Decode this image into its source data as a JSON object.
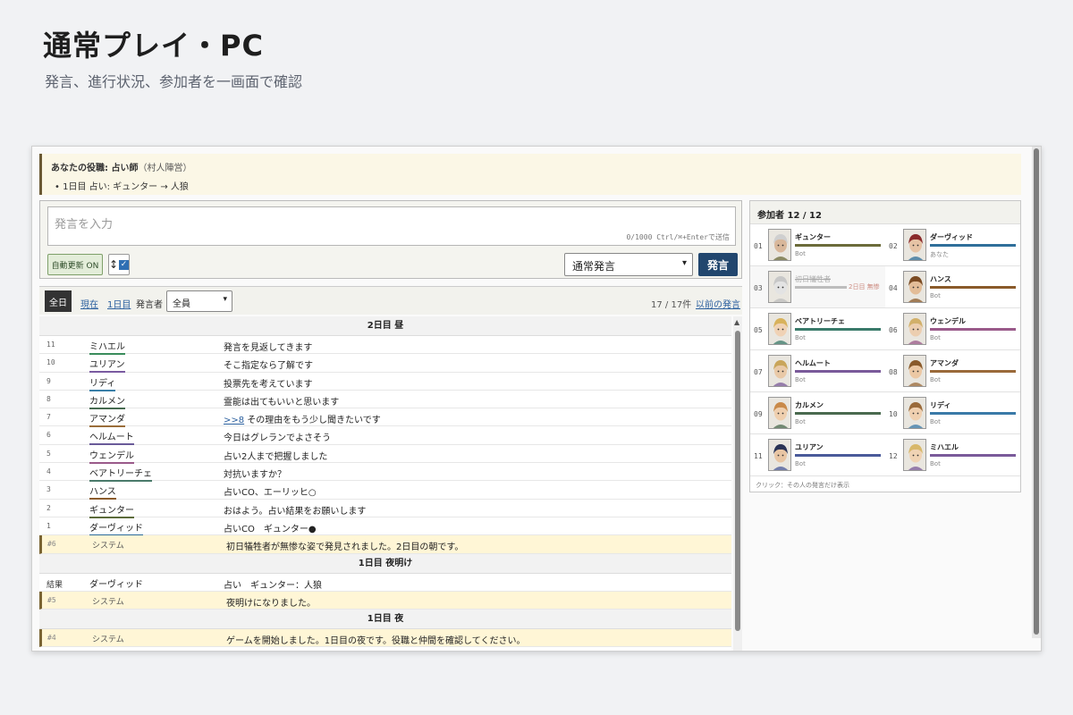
{
  "hero": {
    "title": "通常プレイ・PC",
    "subtitle": "発言、進行状況、参加者を一画面で確認"
  },
  "role": {
    "label": "あなたの役職: 占い師",
    "team": "（村人陣営）",
    "result": "1日目 占い: ギュンター → 人狼"
  },
  "composer": {
    "placeholder": "発言を入力",
    "counter": "0/1000  Ctrl/⌘+Enterで送信",
    "auto_refresh_label": "自動更新 ON",
    "scroll_label": "↕",
    "mode_selected": "通常発言",
    "submit_label": "発言"
  },
  "filter": {
    "all_label": "全日",
    "current_label": "現在",
    "day1_label": "1日目",
    "speaker_label": "発言者",
    "speaker_selected": "全員",
    "count": "17 / 17件",
    "older_label": "以前の発言"
  },
  "log": {
    "day2_header": "2日目 昼",
    "day2_rows": [
      {
        "no": "11",
        "name": "ミハエル",
        "text": "発言を見返してきます",
        "color": "#3a8c5c"
      },
      {
        "no": "10",
        "name": "ユリアン",
        "text": "そこ指定なら了解です",
        "color": "#7a5aa0"
      },
      {
        "no": "9",
        "name": "リディ",
        "text": "投票先を考えています",
        "color": "#3a7fa8"
      },
      {
        "no": "8",
        "name": "カルメン",
        "text": "霊能は出てもいいと思います",
        "color": "#466a4f"
      },
      {
        "no": "7",
        "name": "アマンダ",
        "text": "その理由をもう少し聞きたいです",
        "anchor": ">>8",
        "color": "#9a6d3a"
      },
      {
        "no": "6",
        "name": "ヘルムート",
        "text": "今日はグレランでよさそう",
        "color": "#6a5a99"
      },
      {
        "no": "5",
        "name": "ウェンデル",
        "text": "占い2人まで把握しました",
        "color": "#9a5a8a"
      },
      {
        "no": "4",
        "name": "ベアトリーチェ",
        "text": "対抗いますか？",
        "color": "#4a7a6a"
      },
      {
        "no": "3",
        "name": "ハンス",
        "text": "占いCO、エーリッヒ○",
        "color": "#8a5a2a"
      },
      {
        "no": "2",
        "name": "ギュンター",
        "text": "おはよう。占い結果をお願いします",
        "color": "#5c6b3a"
      },
      {
        "no": "1",
        "name": "ダーヴィッド",
        "text": "占いCO　ギュンター●",
        "color": "#2a6a9a"
      }
    ],
    "sys6": {
      "no": "#6",
      "name": "システム",
      "text": "初日犠牲者が無惨な姿で発見されました。2日目の朝です。"
    },
    "dawn_header": "1日目 夜明け",
    "result_row": {
      "no": "結果",
      "name": "ダーヴィッド",
      "text": "占い　ギュンター：人狼"
    },
    "sys5": {
      "no": "#5",
      "name": "システム",
      "text": "夜明けになりました。"
    },
    "night_header": "1日目 夜",
    "sys4": {
      "no": "#4",
      "name": "システム",
      "text": "ゲームを開始しました。1日目の夜です。役職と仲間を確認してください。"
    }
  },
  "participants": {
    "header": "参加者 12 / 12",
    "footer": "クリック：その人の発言だけ表示",
    "list": [
      {
        "no": "01",
        "name": "ギュンター",
        "type": "Bot",
        "color": "#6b6b3a",
        "hair": "#cfcfcf",
        "skin": "#d8b79a"
      },
      {
        "no": "02",
        "name": "ダーヴィッド",
        "type": "あなた",
        "color": "#2f6f9a",
        "hair": "#8a2a2a",
        "skin": "#e6c3a5"
      },
      {
        "no": "03",
        "name": "初日犠牲者",
        "type": "",
        "color": "#bdbdbd",
        "hair": "#c7c7c7",
        "skin": "#e3e3e3",
        "dead": true,
        "death": "2日目 無惨"
      },
      {
        "no": "04",
        "name": "ハンス",
        "type": "Bot",
        "color": "#8a5a2a",
        "hair": "#7a4a22",
        "skin": "#e3bd98"
      },
      {
        "no": "05",
        "name": "ベアトリーチェ",
        "type": "Bot",
        "color": "#3a7a6a",
        "hair": "#d8b25c",
        "skin": "#f0d2b5"
      },
      {
        "no": "06",
        "name": "ウェンデル",
        "type": "Bot",
        "color": "#9a5a8a",
        "hair": "#d2b06a",
        "skin": "#ecceb0"
      },
      {
        "no": "07",
        "name": "ヘルムート",
        "type": "Bot",
        "color": "#7a5a9a",
        "hair": "#c9a55a",
        "skin": "#e9c9a7"
      },
      {
        "no": "08",
        "name": "アマンダ",
        "type": "Bot",
        "color": "#9a6a3a",
        "hair": "#8a5a2a",
        "skin": "#ecc8a4"
      },
      {
        "no": "09",
        "name": "カルメン",
        "type": "Bot",
        "color": "#4a6a4f",
        "hair": "#c98a4a",
        "skin": "#efcfae"
      },
      {
        "no": "10",
        "name": "リディ",
        "type": "Bot",
        "color": "#3a7aa8",
        "hair": "#9a6a3a",
        "skin": "#f0d0b0"
      },
      {
        "no": "11",
        "name": "ユリアン",
        "type": "Bot",
        "color": "#4a5a9a",
        "hair": "#2a3355",
        "skin": "#e8c5a3"
      },
      {
        "no": "12",
        "name": "ミハエル",
        "type": "Bot",
        "color": "#7a5a9a",
        "hair": "#d8b86a",
        "skin": "#f0d3b4"
      }
    ]
  }
}
